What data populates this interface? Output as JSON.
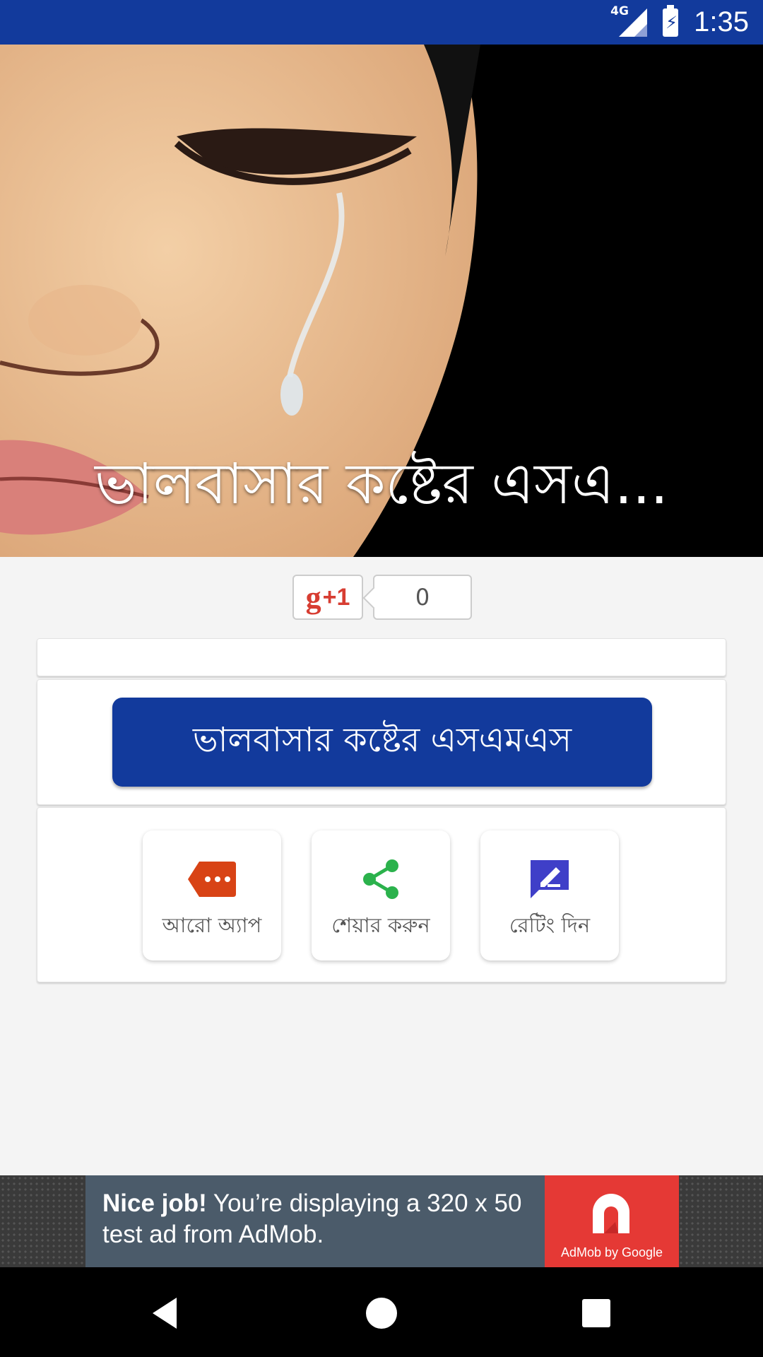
{
  "status_bar": {
    "network": "4G",
    "time": "1:35"
  },
  "hero": {
    "title": "ভালবাসার কষ্টের এসএ..."
  },
  "gplus": {
    "label": "g",
    "plus": "+1",
    "count": "0"
  },
  "main": {
    "button_label": "ভালবাসার কষ্টের এসএমএস"
  },
  "actions": [
    {
      "label": "আরো অ্যাপ",
      "icon": "more-apps-tag-icon",
      "color": "#d84315"
    },
    {
      "label": "শেয়ার করুন",
      "icon": "share-icon",
      "color": "#2bb24c"
    },
    {
      "label": "রেটিং দিন",
      "icon": "rate-feedback-icon",
      "color": "#3f3fc8"
    }
  ],
  "ad": {
    "headline": "Nice job!",
    "text": " You’re displaying a 320 x 50 test ad from AdMob.",
    "brand": "AdMob by Google"
  },
  "colors": {
    "primary": "#123a9c",
    "ad_red": "#e53935"
  }
}
